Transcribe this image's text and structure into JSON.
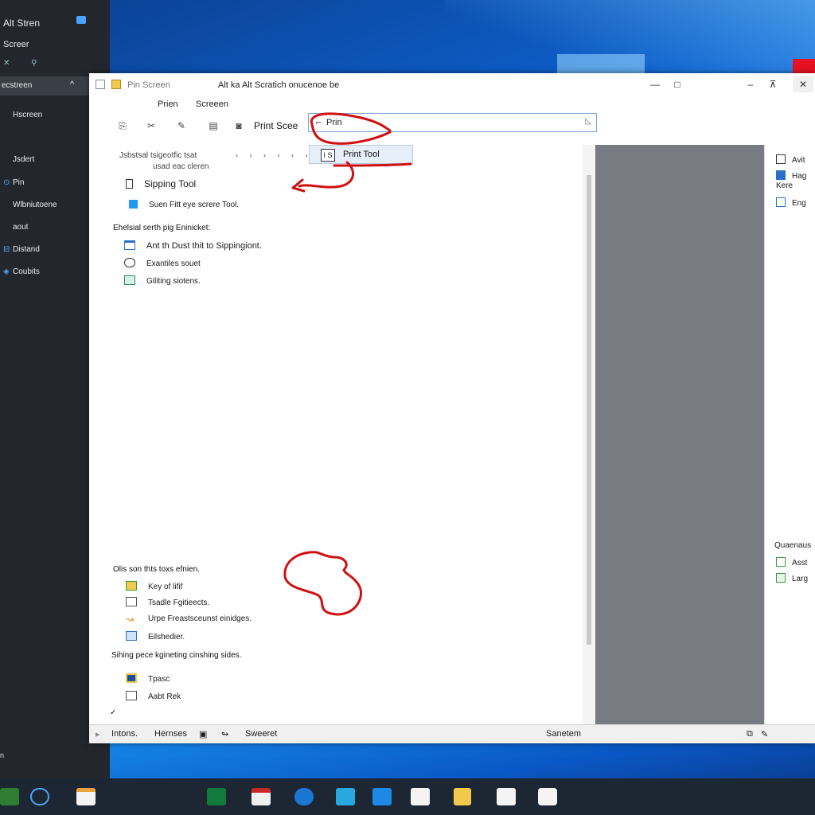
{
  "left_panel": {
    "title": "Alt Stren",
    "subtitle": "Screer",
    "icons": "✕ ⚲",
    "selected": "ecstreen",
    "items": [
      {
        "label": "Hscreen",
        "icon": ""
      },
      {
        "label": "Jsdert",
        "icon": ""
      },
      {
        "label": "Pin",
        "icon": "⊙"
      },
      {
        "label": "Wlbniutoene",
        "icon": ""
      },
      {
        "label": "aout",
        "icon": ""
      },
      {
        "label": "Distand",
        "icon": "⊟"
      },
      {
        "label": "Coubits",
        "icon": "◈"
      }
    ],
    "bottom": "n"
  },
  "window": {
    "app_name": "Pin Screen",
    "title": "Alt ka Alt Scratich onucenoe be",
    "minimize": "—",
    "maximize": "□",
    "menu": [
      "Prien",
      "Screeen"
    ],
    "toolbar_label": "Print Scee",
    "search": {
      "value": "Prin"
    },
    "suggestion": {
      "icon_text": "I S",
      "label": "Print Tool"
    },
    "content": {
      "crumb": "Jsbstsal tsigeotfic tsat",
      "crumb2": "usad eac cleren",
      "crumb_arrows": "› › › › › ›",
      "top_items": [
        {
          "label": "Sipping Tool",
          "icon": "doc"
        },
        {
          "label": "Suen Fitt eye screre Tool.",
          "icon": "blue"
        }
      ],
      "section1": "Ehelsial serth pig Eninicket:",
      "section1_items": [
        {
          "label": "Ant th Dust thit to Sippingiont.",
          "icon": "screen"
        },
        {
          "label": "Exantiles souet",
          "icon": "link"
        },
        {
          "label": "Giliting siotens.",
          "icon": "img"
        }
      ],
      "section2": "Olis son thts toxs efnien.",
      "section2_items": [
        {
          "label": "Key of lifif",
          "icon": "folder"
        },
        {
          "label": "Tsadle Fgitieects.",
          "icon": "doc2"
        },
        {
          "label": "Urpe Freastsceunst einidges.",
          "icon": "pen"
        },
        {
          "label": "Eilshedier.",
          "icon": "grid"
        }
      ],
      "section3": "Sihing pece kgineting cinshing sides.",
      "section3_items": [
        {
          "label": "Tpasc",
          "icon": "pic"
        },
        {
          "label": "Aabt Rek",
          "icon": "doc3"
        }
      ]
    },
    "right_pane": {
      "items": [
        "Avit",
        "Hag Kere",
        "Eng"
      ],
      "section": "Quaenaus",
      "section_items": [
        "Asst",
        "Larg"
      ]
    },
    "status": {
      "left": "Intons.",
      "middle": "Hernses",
      "third": "Sweeret",
      "right": "Sanetem"
    }
  },
  "taskbar": {
    "icons": [
      "start-folder-icon",
      "edge-icon",
      "store-icon",
      "excel-icon",
      "office-icon",
      "skype-icon",
      "photos-icon",
      "cmd-icon",
      "paint-icon",
      "notes-icon",
      "settings-icon",
      "search-circle-icon"
    ]
  },
  "colors": {
    "accent": "#0a5fc4",
    "annotation": "#d01010",
    "grey_pane": "#787b82"
  }
}
